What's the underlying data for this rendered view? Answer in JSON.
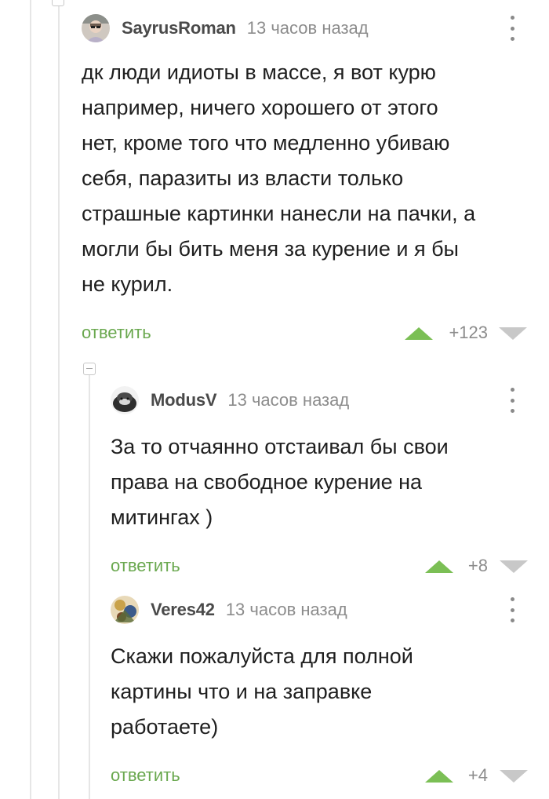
{
  "comments": [
    {
      "username": "SayrusRoman",
      "timestamp": "13 часов назад",
      "text": "дк люди идиоты в массе, я вот курю\nнапример, ничего хорошего от этого\nнет, кроме того что медленно убиваю\nсебя, паразиты из власти только\nстрашные картинки нанесли на пачки, а\nмогли бы бить меня за курение и я бы\nне курил.",
      "reply_label": "ответить",
      "score": "+123",
      "avatar_icon": "avatar-user-icon"
    },
    {
      "username": "ModusV",
      "timestamp": "13 часов назад",
      "text": "За то отчаянно отстаивал бы свои\nправа на свободное курение на\nмитингах )",
      "reply_label": "ответить",
      "score": "+8",
      "avatar_icon": "avatar-user-icon"
    },
    {
      "username": "Veres42",
      "timestamp": "13 часов назад",
      "text": "Скажи пожалуйста для полной\nкартины что и на заправке\nработаете)",
      "reply_label": "ответить",
      "score": "+4",
      "avatar_icon": "avatar-user-icon"
    }
  ],
  "colors": {
    "reply": "#6aa84f",
    "vote_up": "#7bbf55",
    "vote_down": "#c8c8c8",
    "muted_text": "#8c8c8c",
    "username": "#4a4a4a"
  }
}
